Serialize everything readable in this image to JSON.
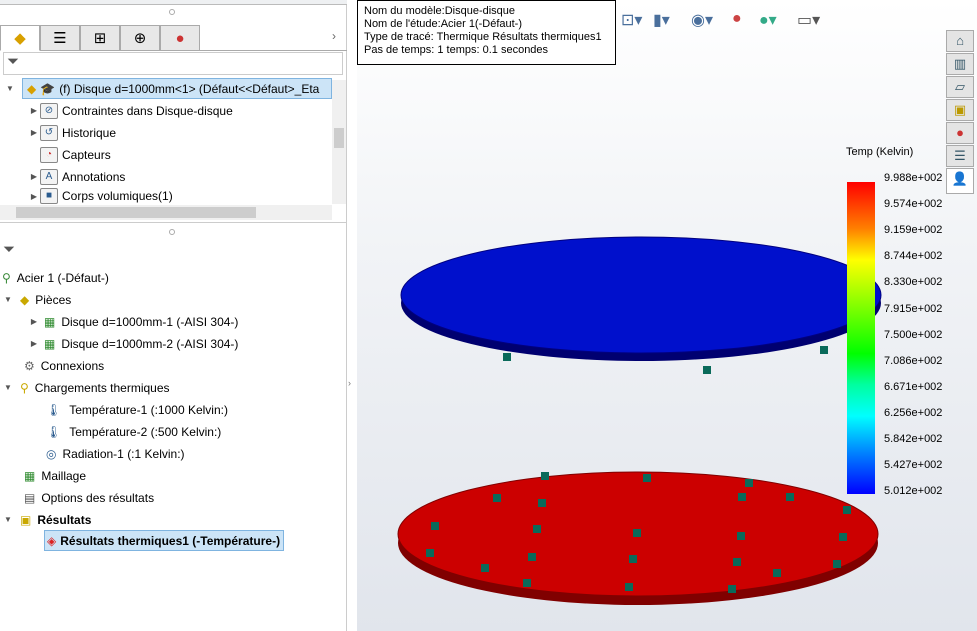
{
  "feature_tree": {
    "tabs": [
      "feature-manager",
      "property-manager",
      "configuration-manager",
      "dimxpert-manager",
      "display-manager"
    ],
    "root": "(f) Disque d=1000mm<1> (Défaut<<Défaut>_Eta",
    "items": [
      "Contraintes dans Disque-disque",
      "Historique",
      "Capteurs",
      "Annotations",
      "Corps volumiques(1)"
    ]
  },
  "study_tree": {
    "study": "Acier 1 (-Défaut-)",
    "pieces": "Pièces",
    "piece_items": [
      "Disque d=1000mm-1 (-AISI 304-)",
      "Disque d=1000mm-2 (-AISI 304-)"
    ],
    "connexions": "Connexions",
    "loads": "Chargements thermiques",
    "load_items": [
      "Température-1 (:1000 Kelvin:)",
      "Température-2 (:500 Kelvin:)",
      "Radiation-1 (:1 Kelvin:)"
    ],
    "mesh": "Maillage",
    "options": "Options des résultats",
    "results": "Résultats",
    "result_item": "Résultats thermiques1 (-Température-)"
  },
  "info": {
    "model": "Nom du modèle:Disque-disque",
    "study": "Nom de l'étude:Acier 1(-Défaut-)",
    "plot": "Type de tracé: Thermique Résultats thermiques1",
    "step": "Pas de temps: 1   temps: 0.1 secondes"
  },
  "legend": {
    "title": "Temp (Kelvin)",
    "values": [
      "9.988e+002",
      "9.574e+002",
      "9.159e+002",
      "8.744e+002",
      "8.330e+002",
      "7.915e+002",
      "7.500e+002",
      "7.086e+002",
      "6.671e+002",
      "6.256e+002",
      "5.842e+002",
      "5.427e+002",
      "5.012e+002"
    ]
  },
  "colors": {
    "hot": "#cc0000",
    "cold": "#0000cc",
    "selection": "#cce4f7"
  }
}
